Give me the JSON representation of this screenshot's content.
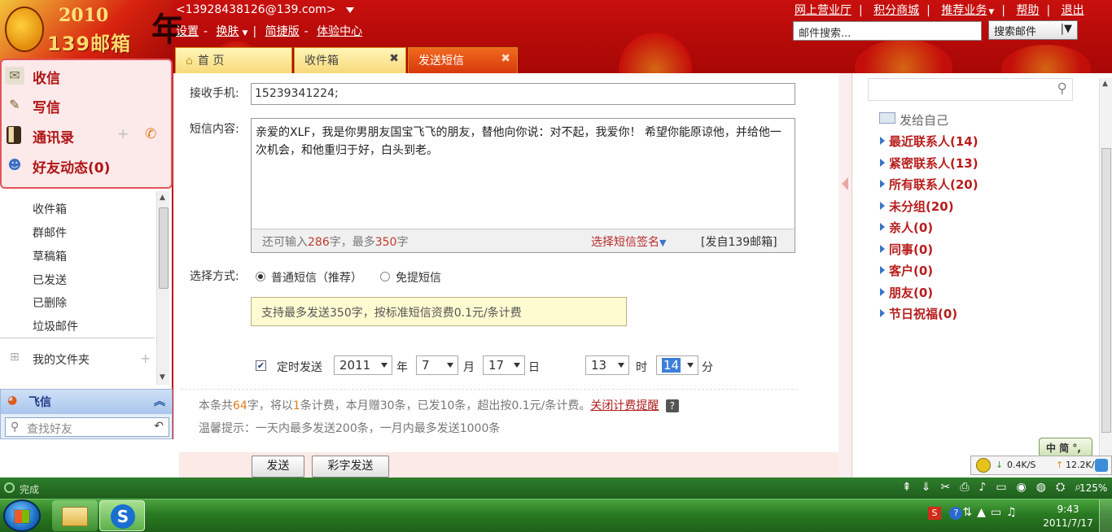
{
  "header": {
    "user_email": "<13928438126@139.com>",
    "links": [
      "设置",
      "换肤",
      "简捷版",
      "体验中心"
    ],
    "top_links": [
      "网上营业厅",
      "积分商城",
      "推荐业务",
      "帮助",
      "退出"
    ],
    "search_placeholder": "邮件搜索...",
    "search_button": "搜索邮件",
    "logo_year": "2010",
    "logo_name": "139邮箱"
  },
  "tabs": [
    {
      "label": "首 页"
    },
    {
      "label": "收件箱"
    },
    {
      "label": "发送短信"
    }
  ],
  "quicknav": [
    {
      "label": "收信"
    },
    {
      "label": "写信"
    },
    {
      "label": "通讯录"
    },
    {
      "label": "好友动态(0)"
    }
  ],
  "folders": [
    "收件箱",
    "群邮件",
    "草稿箱",
    "已发送",
    "已删除",
    "垃圾邮件"
  ],
  "my_folders": "我的文件夹",
  "feixin": {
    "title": "飞信",
    "search_placeholder": "查找好友"
  },
  "sms": {
    "recipient_label": "接收手机:",
    "recipient_value": "15239341224;",
    "content_label": "短信内容:",
    "content": "亲爱的XLF，我是你男朋友国宝飞飞的朋友，替他向你说：对不起，我爱你！ 希望你能原谅他，并给他一次机会，和他重归于好，白头到老。",
    "remain_prefix": "还可输入",
    "remain_count": "286",
    "remain_mid": "字，最多",
    "max_count": "350",
    "remain_suffix": "字",
    "signature_link": "选择短信签名",
    "from_tag": "[发自139邮箱]",
    "method_label": "选择方式:",
    "method_normal": "普通短信（推荐）",
    "method_free": "免提短信",
    "hint": "支持最多发送350字，按标准短信资费0.1元/条计费",
    "timed_label": "定时发送",
    "year": "2011",
    "year_unit": "年",
    "month": "7",
    "month_unit": "月",
    "day": "17",
    "day_unit": "日",
    "hour": "13",
    "hour_unit": "时",
    "minute": "14",
    "minute_unit": "分",
    "billing_a": "本条共",
    "billing_chars": "64",
    "billing_b": "字，将以",
    "billing_count": "1",
    "billing_c": "条计费，本月赠30条，已发10条，超出按0.1元/条计费。",
    "billing_link": "关闭计费提醒",
    "tip": "温馨提示：一天内最多发送200条，一月内最多发送1000条",
    "send_button": "发送",
    "color_send_button": "彩字发送"
  },
  "contacts": {
    "self": "发给自己",
    "groups": [
      "最近联系人(14)",
      "紧密联系人(13)",
      "所有联系人(20)",
      "未分组(20)",
      "亲人(0)",
      "同事(0)",
      "客户(0)",
      "朋友(0)",
      "节日祝福(0)"
    ]
  },
  "ime_label": "中 简 °,",
  "speed": {
    "down": "0.4K/S",
    "up": "12.2K/S"
  },
  "statusbar": {
    "status": "完成",
    "zoom": "125%"
  },
  "clock": {
    "time": "9:43",
    "date": "2011/7/17"
  }
}
